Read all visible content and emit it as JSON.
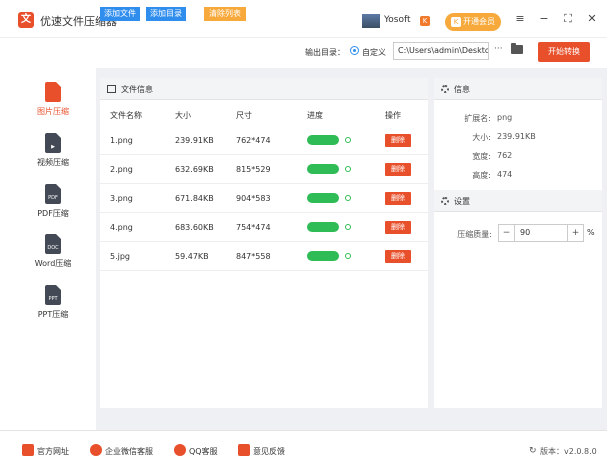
{
  "app": {
    "title": "优速文件压缩器",
    "logo_glyph": "文"
  },
  "user": {
    "name": "Yosoft",
    "badge": "K",
    "vip_label": "开通会员"
  },
  "window": {
    "menu_glyph": "≡",
    "min_glyph": "−",
    "max_glyph": "⛶",
    "close_glyph": "✕"
  },
  "toolbar": {
    "add_file": "添加文件",
    "add_dir": "添加目录",
    "clear_list": "清除列表",
    "output_label": "输出目录：",
    "custom_label": "自定义",
    "path_value": "C:\\Users\\admin\\Deskto",
    "browse_dots": "···",
    "start": "开始转换"
  },
  "sidebar": {
    "items": [
      {
        "label": "图片压缩",
        "icon": "image-file-icon",
        "active": true,
        "color": "#e8502c",
        "glyph": ""
      },
      {
        "label": "视频压缩",
        "icon": "video-file-icon",
        "active": false,
        "color": "#444a55",
        "glyph": "▶"
      },
      {
        "label": "PDF压缩",
        "icon": "pdf-file-icon",
        "active": false,
        "color": "#444a55",
        "glyph": "PDF"
      },
      {
        "label": "Word压缩",
        "icon": "doc-file-icon",
        "active": false,
        "color": "#444a55",
        "glyph": "DOC"
      },
      {
        "label": "PPT压缩",
        "icon": "ppt-file-icon",
        "active": false,
        "color": "#444a55",
        "glyph": "PPT"
      }
    ]
  },
  "file_panel": {
    "title": "文件信息",
    "columns": [
      "文件名称",
      "大小",
      "尺寸",
      "进度",
      "操作"
    ],
    "rows": [
      {
        "name": "1.png",
        "size": "239.91KB",
        "dims": "762*474",
        "progress": 1.0,
        "action": "删除"
      },
      {
        "name": "2.png",
        "size": "632.69KB",
        "dims": "815*529",
        "progress": 1.0,
        "action": "删除"
      },
      {
        "name": "3.png",
        "size": "671.84KB",
        "dims": "904*583",
        "progress": 1.0,
        "action": "删除"
      },
      {
        "name": "4.png",
        "size": "683.60KB",
        "dims": "754*474",
        "progress": 1.0,
        "action": "删除"
      },
      {
        "name": "5.jpg",
        "size": "59.47KB",
        "dims": "847*558",
        "progress": 1.0,
        "action": "删除"
      }
    ]
  },
  "info_panel": {
    "title": "信息",
    "ext_label": "扩展名:",
    "ext_value": "png",
    "size_label": "大小:",
    "size_value": "239.91KB",
    "width_label": "宽度:",
    "width_value": "762",
    "height_label": "高度:",
    "height_value": "474"
  },
  "settings_panel": {
    "title": "设置",
    "quality_label": "压缩质量:",
    "quality_value": "90",
    "minus": "−",
    "plus": "+",
    "unit": "%"
  },
  "footer": {
    "links": [
      {
        "label": "官方网址",
        "icon": "website-icon"
      },
      {
        "label": "企业微信客服",
        "icon": "wechat-icon"
      },
      {
        "label": "QQ客服",
        "icon": "qq-icon"
      },
      {
        "label": "意见反馈",
        "icon": "feedback-icon"
      }
    ],
    "version": "版本：v2.0.8.0"
  },
  "colors": {
    "accent": "#e8502c",
    "blue": "#2f8ded",
    "orange": "#f7a93c",
    "progress": "#2fbc57"
  }
}
